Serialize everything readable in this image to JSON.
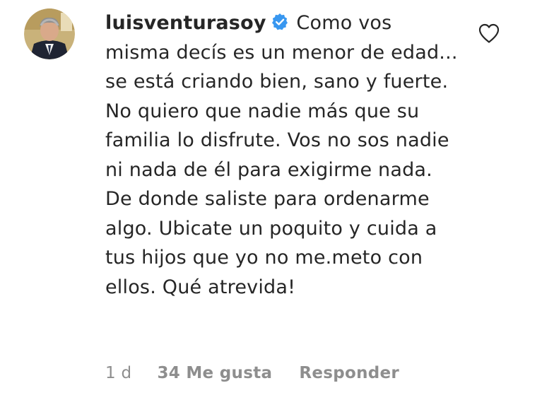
{
  "comment": {
    "username": "luisventurasoy",
    "verified_icon": "verified-badge-icon",
    "text": "Como vos misma decís es un menor de edad... se está criando bien, sano y fuerte. No quiero que nadie más que su familia lo disfrute. Vos no sos nadie ni nada de él para exigirme nada. De donde saliste para ordenarme algo. Ubicate un poquito y cuida a tus hijos que yo no me.meto con ellos. Qué atrevida!",
    "like_icon": "heart-outline-icon",
    "avatar_icon": "user-avatar",
    "time": "1 d",
    "likes": "34 Me gusta",
    "reply_label": "Responder",
    "accent_color": "#3897f0",
    "meta_color": "#8e8e8e"
  }
}
